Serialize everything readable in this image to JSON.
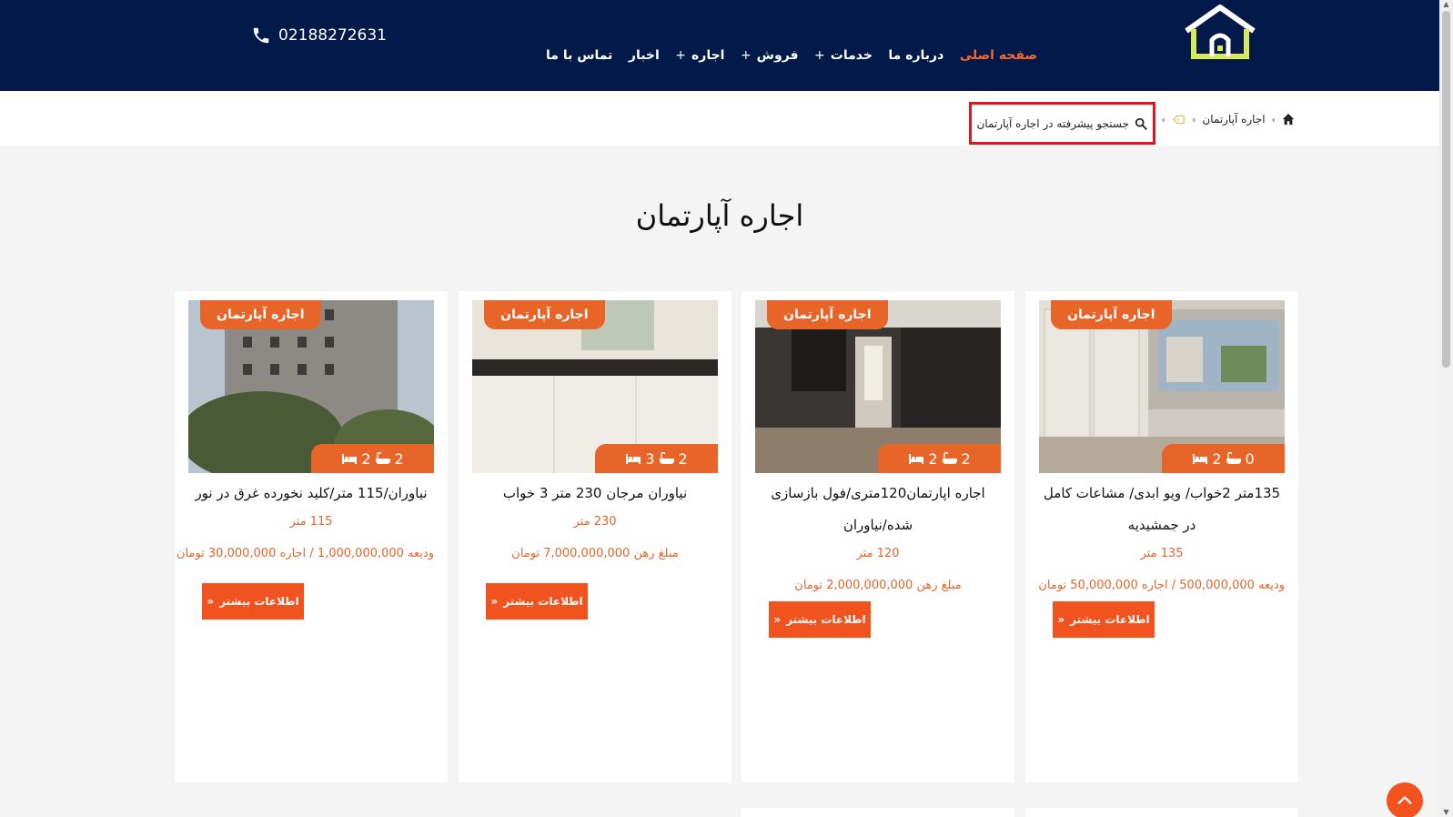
{
  "header": {
    "phone": "02188272631",
    "nav": [
      {
        "label": "صفحه اصلی",
        "plus": false,
        "active": true
      },
      {
        "label": "درباره ما",
        "plus": false,
        "active": false
      },
      {
        "label": "خدمات",
        "plus": true,
        "active": false
      },
      {
        "label": "فروش",
        "plus": true,
        "active": false
      },
      {
        "label": "اجاره",
        "plus": true,
        "active": false
      },
      {
        "label": "اخبار",
        "plus": false,
        "active": false
      },
      {
        "label": "تماس با ما",
        "plus": false,
        "active": false
      }
    ],
    "plus_symbol": "+"
  },
  "breadcrumb": {
    "home_icon": "home-icon",
    "item": "اجاره آپارتمان",
    "tag_icon": "tag-icon",
    "search_label": "جستجو پیشرفته در اجاره آپارتمان"
  },
  "page_title": "اجاره آپارتمان",
  "cards": [
    {
      "tag": "اجاره آپارتمان",
      "bedrooms": "0",
      "bathrooms": "2",
      "title": "135متر 2خواب/ ویو ابدی/ مشاعات کامل در جمشیدیه",
      "area": "135 متر",
      "price": "ودیعه 500,000,000 / اجاره 50,000,000  تومان",
      "button": "اطلاعات بیشتر"
    },
    {
      "tag": "اجاره آپارتمان",
      "bedrooms": "2",
      "bathrooms": "2",
      "title": "اجاره اپارتمان120متری/فول بازسازی شده/نیاوران",
      "area": "120 متر",
      "price": "مبلغ رهن 2,000,000,000 تومان",
      "button": "اطلاعات بیشتر"
    },
    {
      "tag": "اجاره آپارتمان",
      "bedrooms": "2",
      "bathrooms": "3",
      "title": "نیاوران مرجان 230 متر 3 خواب",
      "area": "230 متر",
      "price": "مبلغ رهن 7,000,000,000 تومان",
      "button": "اطلاعات بیشتر"
    },
    {
      "tag": "اجاره آپارتمان",
      "bedrooms": "2",
      "bathrooms": "2",
      "title": "نیاوران/115 متر/کلید نخورده غرق در نور",
      "area": "115 متر",
      "price": "ودیعه 1,000,000,000 / اجاره 30,000,000  تومان",
      "button": "اطلاعات بیشتر"
    }
  ],
  "colors": {
    "header_bg": "#02194a",
    "accent": "#f0531e",
    "active_nav": "#f26a2a",
    "highlight_box": "#e4141b"
  }
}
